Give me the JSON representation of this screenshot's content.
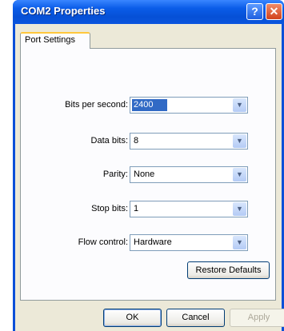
{
  "window": {
    "title": "COM2 Properties",
    "help_glyph": "?",
    "close_glyph": "✕"
  },
  "tabs": [
    {
      "label": "Port Settings",
      "active": true
    }
  ],
  "fields": [
    {
      "label": "Bits per second:",
      "value": "2400",
      "selected": true
    },
    {
      "label": "Data bits:",
      "value": "8"
    },
    {
      "label": "Parity:",
      "value": "None"
    },
    {
      "label": "Stop bits:",
      "value": "1"
    },
    {
      "label": "Flow control:",
      "value": "Hardware"
    }
  ],
  "dropdown_glyph": "▼",
  "restore_label": "Restore Defaults",
  "buttons": {
    "ok": "OK",
    "cancel": "Cancel",
    "apply": "Apply"
  },
  "colors": {
    "titlebar": "#0a5ce8",
    "selection": "#316ac5",
    "dialog_bg": "#ece9d8",
    "tab_highlight": "#ffc73c"
  }
}
